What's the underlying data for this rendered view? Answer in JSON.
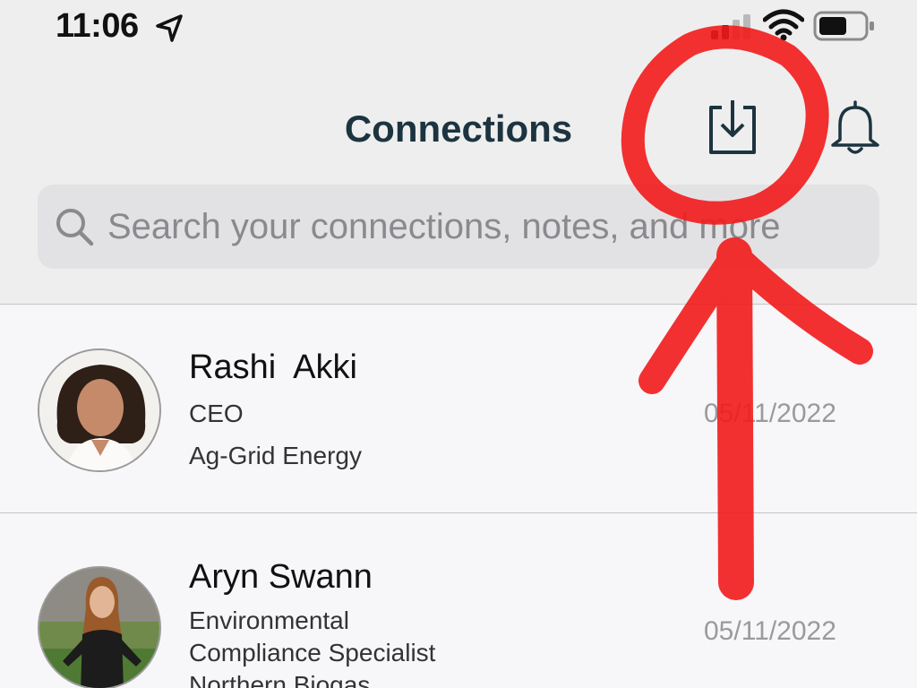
{
  "status_bar": {
    "time": "11:06",
    "location_icon": "location-arrow-icon",
    "signal_icon": "cellular-signal-icon",
    "wifi_icon": "wifi-icon",
    "battery_icon": "battery-icon"
  },
  "header": {
    "title": "Connections",
    "download_icon": "download-icon",
    "bell_icon": "bell-icon"
  },
  "search": {
    "placeholder": "Search your connections, notes, and more",
    "value": "",
    "icon": "magnifying-glass-icon"
  },
  "connections": [
    {
      "name": "Rashi  Akki",
      "title": "CEO",
      "company": "Ag-Grid Energy",
      "date": "05/11/2022"
    },
    {
      "name": "Aryn Swann",
      "title_line1": "Environmental",
      "title_line2": "Compliance Specialist",
      "company": "Northern Biogas",
      "date": "05/11/2022"
    }
  ],
  "colors": {
    "title": "#1c3440",
    "annotation": "#f21b1b",
    "date": "#9a9a9c",
    "search_bg": "#e2e2e4"
  }
}
